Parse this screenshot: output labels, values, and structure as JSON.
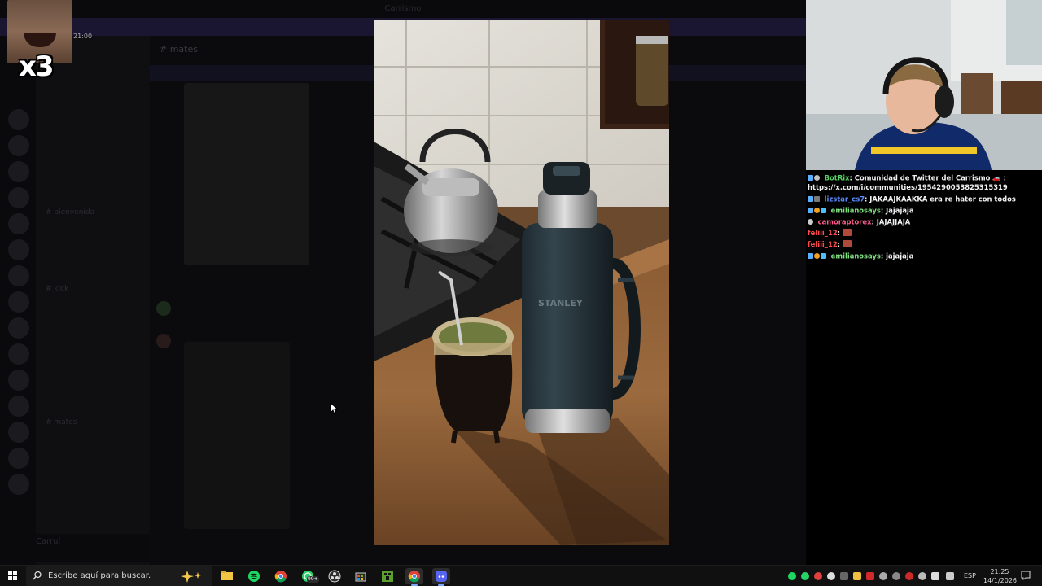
{
  "window": {
    "title": "Carrismo"
  },
  "discord": {
    "channel_header": "mates",
    "pinned_banner": "",
    "message_text": "",
    "channels": [
      "bienvenida",
      "kick",
      "mates"
    ],
    "user_name": "Carruí"
  },
  "overlay": {
    "multiplier": "x3",
    "time": "21:00"
  },
  "chat": {
    "messages": [
      {
        "user": "BotRix",
        "user_color": "#56d364",
        "text": ": Comunidad de Twitter del Carrismo 🚗 :",
        "badges": [
          "#5ab0ff",
          "#c2c2c2"
        ]
      },
      {
        "user": "",
        "user_color": "#ffffff",
        "text": "https://x.com/i/communities/1954290053825315319",
        "badges": []
      },
      {
        "user": "lizstar_cs7",
        "user_color": "#5a8cff",
        "text": ": JAKAAJKAAKKA era re hater con todos",
        "badges": [
          "#5ab0ff",
          "#7a7a7a"
        ]
      },
      {
        "user": "emilianosays",
        "user_color": "#7fe07f",
        "text": ": Jajajaja",
        "badges": [
          "#5ab0ff",
          "#f0a020",
          "#4ac0ff"
        ]
      },
      {
        "user": "camoraptorex",
        "user_color": "#ff5d8f",
        "text": ": JAJAJJAJA",
        "badges": [
          "#cccccc"
        ]
      },
      {
        "user": "feliii_12",
        "user_color": "#ff4b4b",
        "text": ":",
        "badges": []
      },
      {
        "user": "feliii_12",
        "user_color": "#ff4b4b",
        "text": ":",
        "badges": []
      },
      {
        "user": "emilianosays",
        "user_color": "#7fe07f",
        "text": ": jajajaja",
        "badges": [
          "#5ab0ff",
          "#f0a020",
          "#4ac0ff"
        ]
      }
    ]
  },
  "taskbar": {
    "search_placeholder": "Escribe aquí para buscar.",
    "whatsapp_badge": "99+",
    "language": "ESP",
    "time": "21:25",
    "date": "14/1/2026",
    "apps": [
      "file-explorer",
      "spotify",
      "chrome",
      "whatsapp",
      "obs",
      "store",
      "minecraft",
      "chrome-profile",
      "discord"
    ]
  },
  "viewer": {
    "brand_text": "STANLEY"
  }
}
